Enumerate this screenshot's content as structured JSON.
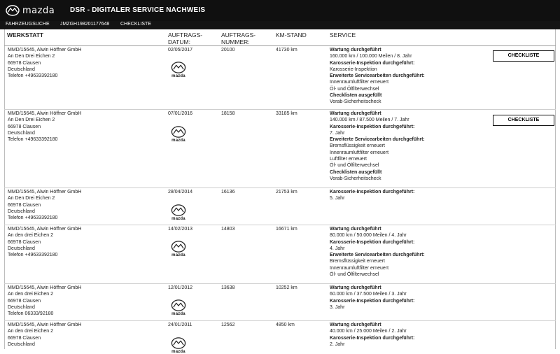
{
  "header": {
    "brand": "mazda",
    "app_title": "DSR - DIGITALER SERVICE NACHWEIS"
  },
  "subnav": {
    "item1": "FAHRZEUGSUCHE",
    "vin": "JMZGH198201177648",
    "item3": "CHECKLISTE"
  },
  "table": {
    "columns": {
      "werkstatt": "WERKSTATT",
      "datum_1": "AUFTRAGS-",
      "datum_2": "DATUM:",
      "nummer_1": "AUFTRAGS-",
      "nummer_2": "NUMMER:",
      "km": "KM-STAND",
      "service": "SERVICE"
    },
    "badge_text": "mazda",
    "checklist_label": "CHECKLISTE",
    "rows": [
      {
        "address": [
          "MMD/15645, Alwin Höffner GmbH",
          "An Den Drei Eichen 2",
          "66978 Clausen",
          "Deutschland",
          "Telefon +49633392180"
        ],
        "date": "02/05/2017",
        "order": "20100",
        "km": "41730 km",
        "service": [
          {
            "bold": true,
            "text": "Wartung durchgeführt"
          },
          {
            "bold": false,
            "text": "160.000 km / 100.000 Meilen / 8. Jahr"
          },
          {
            "bold": true,
            "text": "Karosserie-Inspektion durchgeführt:"
          },
          {
            "bold": false,
            "text": "Karosserie-Inspektion"
          },
          {
            "bold": true,
            "text": "Erweiterte Servicearbeiten durchgeführt:"
          },
          {
            "bold": false,
            "text": "Innenraumluftfilter erneuert"
          },
          {
            "bold": false,
            "text": "Öl- und Ölfilterwechsel"
          },
          {
            "bold": true,
            "text": "Checklisten ausgefüllt"
          },
          {
            "bold": false,
            "text": "Vorab-Sicherheitscheck"
          }
        ]
      },
      {
        "address": [
          "MMD/15645, Alwin Höffner GmbH",
          "An Den Drei Eichen 2",
          "66978 Clausen",
          "Deutschland",
          "Telefon +49633392180"
        ],
        "date": "07/01/2016",
        "order": "18158",
        "km": "33185 km",
        "service": [
          {
            "bold": true,
            "text": "Wartung durchgeführt"
          },
          {
            "bold": false,
            "text": "140.000 km / 87.500 Meilen / 7. Jahr"
          },
          {
            "bold": true,
            "text": "Karosserie-Inspektion durchgeführt:"
          },
          {
            "bold": false,
            "text": "7. Jahr"
          },
          {
            "bold": true,
            "text": "Erweiterte Servicearbeiten durchgeführt:"
          },
          {
            "bold": false,
            "text": "Bremsflüssigkeit erneuert"
          },
          {
            "bold": false,
            "text": "Innenraumluftfilter erneuert"
          },
          {
            "bold": false,
            "text": "Luftfilter erneuert"
          },
          {
            "bold": false,
            "text": "Öl- und Ölfilterwechsel"
          },
          {
            "bold": true,
            "text": "Checklisten ausgefüllt"
          },
          {
            "bold": false,
            "text": "Vorab-Sicherheitscheck"
          }
        ]
      },
      {
        "address": [
          "MMD/15645, Alwin Höffner GmbH",
          "An Den Drei Eichen 2",
          "66978 Clausen",
          "Deutschland",
          "Telefon +49633392180"
        ],
        "date": "28/04/2014",
        "order": "16136",
        "km": "21753 km",
        "service": [
          {
            "bold": true,
            "text": "Karosserie-Inspektion durchgeführt:"
          },
          {
            "bold": false,
            "text": "5. Jahr"
          }
        ]
      },
      {
        "address": [
          "MMD/15645, Alwin Höffner GmbH",
          "An den drei Eichen 2",
          "66978 Clausen",
          "Deutschland",
          "Telefon +49633392180"
        ],
        "date": "14/02/2013",
        "order": "14803",
        "km": "16671 km",
        "service": [
          {
            "bold": true,
            "text": "Wartung durchgeführt"
          },
          {
            "bold": false,
            "text": "80.000 km / 50.000 Meilen / 4. Jahr"
          },
          {
            "bold": true,
            "text": "Karosserie-Inspektion durchgeführt:"
          },
          {
            "bold": false,
            "text": "4. Jahr"
          },
          {
            "bold": true,
            "text": "Erweiterte Servicearbeiten durchgeführt:"
          },
          {
            "bold": false,
            "text": "Bremsflüssigkeit erneuert"
          },
          {
            "bold": false,
            "text": "Innenraumluftfilter erneuert"
          },
          {
            "bold": false,
            "text": "Öl- und Ölfilterwechsel"
          }
        ]
      },
      {
        "address": [
          "MMD/15645, Alwin Höffner GmbH",
          "An den drei Eichen 2",
          "66978 Clausen",
          "Deutschland",
          "Telefon 06333/92180"
        ],
        "date": "12/01/2012",
        "order": "13638",
        "km": "10252 km",
        "service": [
          {
            "bold": true,
            "text": "Wartung durchgeführt"
          },
          {
            "bold": false,
            "text": "60.000 km / 37.500 Meilen / 3. Jahr"
          },
          {
            "bold": true,
            "text": "Karosserie-Inspektion durchgeführt:"
          },
          {
            "bold": false,
            "text": "3. Jahr"
          }
        ]
      },
      {
        "address": [
          "MMD/15645, Alwin Höffner GmbH",
          "An den drei Eichen 2",
          "66978 Clausen",
          "Deutschland"
        ],
        "date": "24/01/2011",
        "order": "12562",
        "km": "4850 km",
        "service": [
          {
            "bold": true,
            "text": "Wartung durchgeführt"
          },
          {
            "bold": false,
            "text": "40.000 km / 25.000 Meilen / 2. Jahr"
          },
          {
            "bold": true,
            "text": "Karosserie-Inspektion durchgeführt:"
          },
          {
            "bold": false,
            "text": "2. Jahr"
          }
        ]
      }
    ]
  }
}
